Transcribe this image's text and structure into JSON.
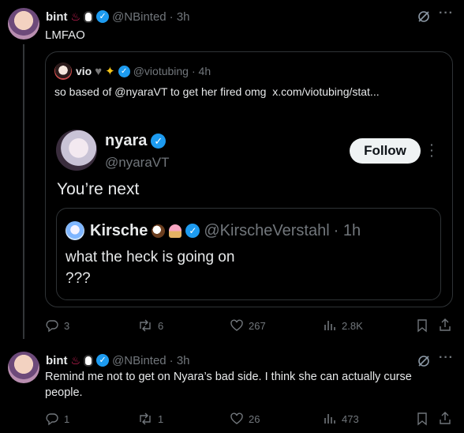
{
  "tweet1": {
    "name": "bint",
    "handle": "@NBinted",
    "time": "· 3h",
    "text": "LMFAO",
    "actions": {
      "replies": "3",
      "retweets": "6",
      "likes": "267",
      "views": "2.8K"
    }
  },
  "quote": {
    "name": "vio",
    "handle": "@viotubing",
    "time": "· 4h",
    "text": "so based of @nyaraVT to get her fired omg  x.com/viotubing/stat..."
  },
  "embed": {
    "name": "nyara",
    "handle": "@nyaraVT",
    "follow_label": "Follow",
    "text": "You’re next",
    "inner": {
      "name": "Kirsche",
      "handle": "@KirscheVerstahl",
      "time": "· 1h",
      "line1": "what the heck is going on",
      "line2": "???"
    }
  },
  "tweet2": {
    "name": "bint",
    "handle": "@NBinted",
    "time": "· 3h",
    "text_line1": "Remind me not to get on Nyara’s bad side. I think she can actually curse",
    "text_line2": "people.",
    "actions": {
      "replies": "1",
      "retweets": "1",
      "likes": "26",
      "views": "473"
    }
  },
  "colors": {
    "accent": "#1d9bf0",
    "muted": "#71767b",
    "border": "#2f3336"
  }
}
